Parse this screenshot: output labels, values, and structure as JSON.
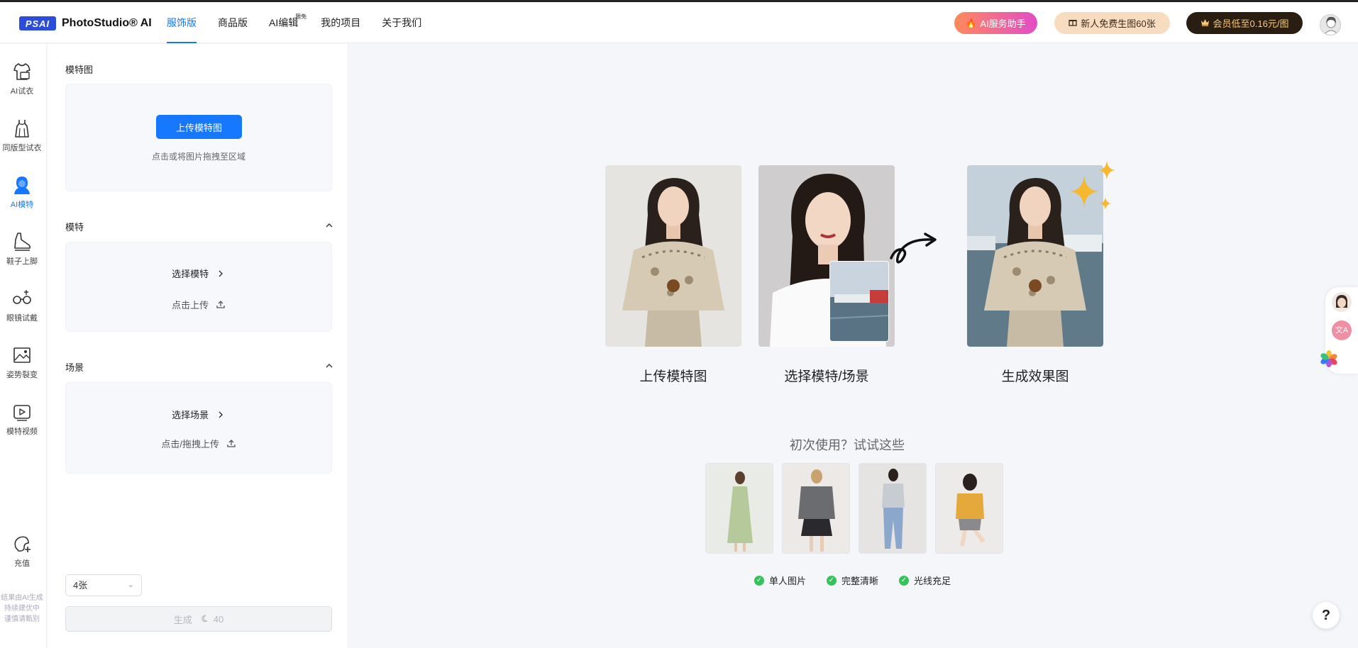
{
  "header": {
    "logo_badge": "PSAI",
    "logo_text": "PhotoStudio® AI",
    "nav": [
      {
        "label": "服饰版",
        "active": true
      },
      {
        "label": "商品版"
      },
      {
        "label": "AI编辑",
        "badge": "限免"
      },
      {
        "label": "我的项目"
      },
      {
        "label": "关于我们"
      }
    ],
    "ai_assistant": "AI服务助手",
    "new_user": "新人免费生图60张",
    "vip": "会员低至0.16元/图"
  },
  "sidebar": {
    "items": [
      {
        "label": "AI试衣",
        "icon": "shirt-icon"
      },
      {
        "label": "同版型试衣",
        "icon": "dress-icon"
      },
      {
        "label": "AI模特",
        "icon": "model-icon",
        "active": true
      },
      {
        "label": "鞋子上脚",
        "icon": "shoe-icon"
      },
      {
        "label": "眼镜试戴",
        "icon": "glasses-icon"
      },
      {
        "label": "姿势裂变",
        "icon": "pose-icon"
      },
      {
        "label": "模特视频",
        "icon": "video-icon"
      }
    ],
    "recharge": "充值",
    "note_lines": [
      "结果由AI生成",
      "持续建优中",
      "谨慎请甄别"
    ]
  },
  "panel": {
    "model_image": {
      "title": "模特图",
      "upload_button": "上传模特图",
      "hint": "点击或将图片拖拽至区域"
    },
    "model": {
      "title": "模特",
      "select": "选择模特",
      "upload": "点击上传"
    },
    "scene": {
      "title": "场景",
      "select": "选择场景",
      "upload": "点击/拖拽上传"
    },
    "count": "4张",
    "generate": "生成",
    "cost": "40"
  },
  "main": {
    "steps": [
      "上传模特图",
      "选择模特/场景",
      "生成效果图"
    ],
    "try_title": "初次使用？试试这些",
    "checks": [
      "单人图片",
      "完整清晰",
      "光线充足"
    ]
  },
  "colors": {
    "primary": "#1677ff",
    "check_green": "#36c25b",
    "sparkle": "#f5b82e"
  }
}
